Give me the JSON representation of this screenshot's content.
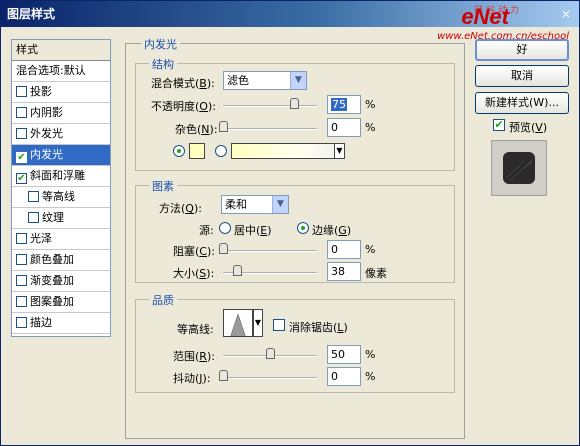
{
  "window": {
    "title": "图层样式",
    "watermark": "eNet",
    "watermark_sub": "硅 谷 动 力",
    "watermark_url": "www.eNet.com.cn/eschool",
    "close_icon": "×"
  },
  "style_list": {
    "header": "样式",
    "blend_options": "混合选项:默认",
    "items": [
      {
        "label": "投影",
        "checked": false
      },
      {
        "label": "内阴影",
        "checked": false
      },
      {
        "label": "外发光",
        "checked": false
      },
      {
        "label": "内发光",
        "checked": true,
        "selected": true
      },
      {
        "label": "斜面和浮雕",
        "checked": true
      },
      {
        "label": "等高线",
        "checked": false,
        "sub": true
      },
      {
        "label": "纹理",
        "checked": false,
        "sub": true
      },
      {
        "label": "光泽",
        "checked": false
      },
      {
        "label": "颜色叠加",
        "checked": false
      },
      {
        "label": "渐变叠加",
        "checked": false
      },
      {
        "label": "图案叠加",
        "checked": false
      },
      {
        "label": "描边",
        "checked": false
      }
    ],
    "check_mark": "✔"
  },
  "inner_glow": {
    "title": "内发光",
    "structure": {
      "title": "结构",
      "blend_mode_label_a": "混合模式(",
      "blend_mode_key": "B",
      "blend_mode_label_b": "):",
      "blend_mode_value": "滤色",
      "opacity_label_a": "不透明度(",
      "opacity_key": "O",
      "opacity_label_b": "):",
      "opacity_value": "75",
      "opacity_percent": 75,
      "noise_label_a": "杂色(",
      "noise_key": "N",
      "noise_label_b": "):",
      "noise_value": "0",
      "noise_percent": 0,
      "percent_sign": "%",
      "glow_color": "#ffffc0"
    },
    "elements": {
      "title": "图素",
      "technique_label_a": "方法(",
      "technique_key": "Q",
      "technique_label_b": "):",
      "technique_value": "柔和",
      "source_label": "源:",
      "source_center_a": "居中(",
      "source_center_key": "E",
      "source_center_b": ")",
      "source_edge_a": "边缘(",
      "source_edge_key": "G",
      "source_edge_b": ")",
      "choke_label_a": "阻塞(",
      "choke_key": "C",
      "choke_label_b": "):",
      "choke_value": "0",
      "choke_percent": 0,
      "size_label_a": "大小(",
      "size_key": "S",
      "size_label_b": "):",
      "size_value": "38",
      "size_fraction": 0.15,
      "size_unit": "像素",
      "percent_sign": "%"
    },
    "quality": {
      "title": "品质",
      "contour_label": "等高线:",
      "anti_alias_a": "消除锯齿(",
      "anti_alias_key": "L",
      "anti_alias_b": ")",
      "range_label_a": "范围(",
      "range_key": "R",
      "range_label_b": "):",
      "range_value": "50",
      "range_percent": 50,
      "jitter_label_a": "抖动(",
      "jitter_key": "J",
      "jitter_label_b": "):",
      "jitter_value": "0",
      "jitter_percent": 0,
      "percent_sign": "%"
    }
  },
  "buttons": {
    "ok": "好",
    "cancel": "取消",
    "new_style": "新建样式(W)...",
    "preview_a": "预览(",
    "preview_key": "V",
    "preview_b": ")"
  },
  "icons": {
    "dropdown": "▼",
    "radio_color": "◉"
  }
}
